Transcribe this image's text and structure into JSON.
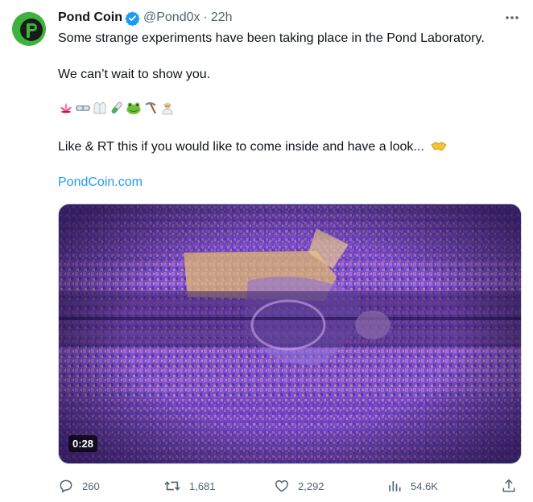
{
  "author": {
    "name": "Pond Coin",
    "handle": "@Pond0x",
    "separator": "·",
    "time": "22h",
    "avatar_letter": "P",
    "avatar_color": "#3cb43c",
    "verified_color": "#1d9bf0"
  },
  "tweet": {
    "line1": "Some strange experiments have been taking place in the Pond Laboratory.",
    "line2": "We can’t wait to show you.",
    "emojis": [
      "lotus-icon",
      "goggles-icon",
      "lab-coat-icon",
      "test-tube-icon",
      "frog-icon",
      "pick-icon",
      "scientist-icon"
    ],
    "line3": "Like & RT this if you would like to come inside and have a look...",
    "line3_emoji": "handshake-icon",
    "link": "PondCoin.com"
  },
  "media": {
    "duration": "0:28"
  },
  "actions": {
    "replies": "260",
    "reposts": "1,681",
    "likes": "2,292",
    "views": "54.6K"
  }
}
